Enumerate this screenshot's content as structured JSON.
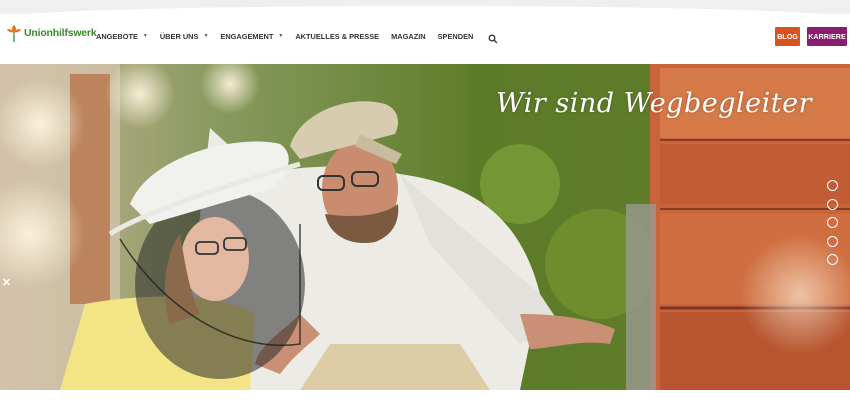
{
  "brand": {
    "name": "Unionhilfswerk",
    "logo_color": "#3a8a2c",
    "logo_accent": "#e07a1f"
  },
  "nav": {
    "items": [
      {
        "label": "ANGEBOTE",
        "has_dropdown": true
      },
      {
        "label": "ÜBER UNS",
        "has_dropdown": true
      },
      {
        "label": "ENGAGEMENT",
        "has_dropdown": true
      },
      {
        "label": "AKTUELLES & PRESSE",
        "has_dropdown": false
      },
      {
        "label": "MAGAZIN",
        "has_dropdown": false
      },
      {
        "label": "SPENDEN",
        "has_dropdown": false
      }
    ],
    "search_icon": "search-icon",
    "dropdown_icon": "caret-down-icon"
  },
  "header_buttons": {
    "blog": {
      "label": "BLOG",
      "color": "#d9531e"
    },
    "karriere": {
      "label": "KARRIERE",
      "color": "#8a1e6e"
    }
  },
  "hero": {
    "headline": "Wir sind Wegbegleiter",
    "slide_count": 5,
    "prev_arrow": "close-icon",
    "prev_symbol": "✕"
  }
}
